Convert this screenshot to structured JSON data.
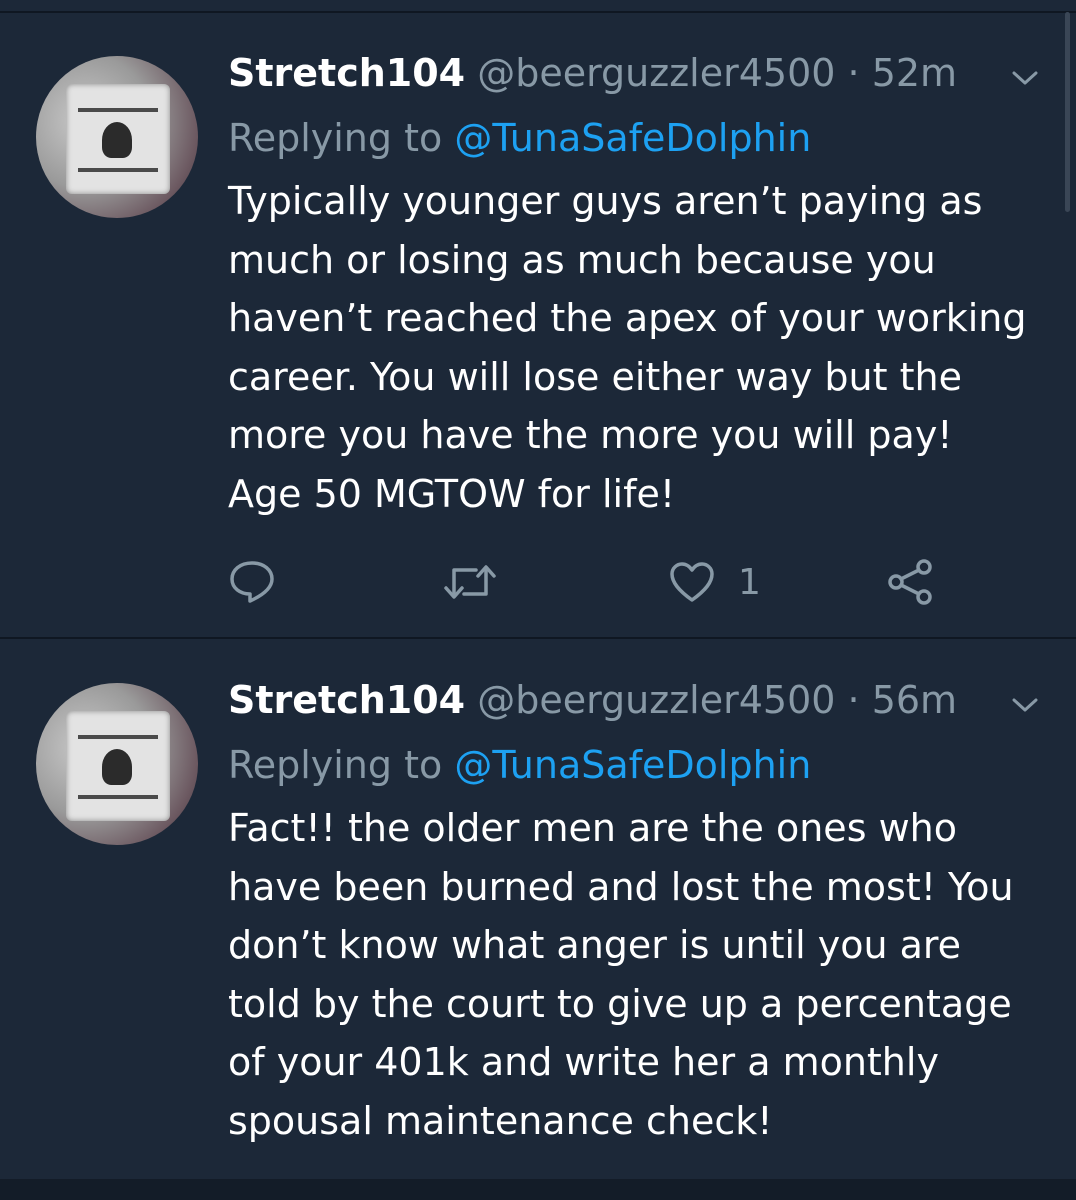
{
  "tweets": [
    {
      "display_name": "Stretch104",
      "handle": "@beerguzzler4500",
      "separator": "·",
      "time": "52m",
      "replying_prefix": "Replying to",
      "replying_to": "@TunaSafeDolphin",
      "body_lines": [
        "Typically younger guys aren’t paying as",
        "much or losing as much because you",
        "haven’t reached the apex of your working",
        "career. You will lose either way but the",
        "more you have the more you will pay!",
        "Age 50 MGTOW for life!"
      ],
      "like_count": "1"
    },
    {
      "display_name": "Stretch104",
      "handle": "@beerguzzler4500",
      "separator": "·",
      "time": "56m",
      "replying_prefix": "Replying to",
      "replying_to": "@TunaSafeDolphin",
      "body_lines": [
        "Fact!! the older men are the ones who",
        "have been burned and lost the most! You",
        "don’t know what anger is until you are",
        "told by the court to give up a percentage",
        "of your 401k and write her a monthly",
        "spousal maintenance check!"
      ]
    }
  ],
  "icons": {
    "reply": "reply-icon",
    "retweet": "retweet-icon",
    "like": "heart-icon",
    "share": "share-icon",
    "menu": "chevron-down-icon"
  },
  "colors": {
    "background": "#1c2838",
    "text": "#ffffff",
    "secondary": "#8899a6",
    "link": "#1da1f2"
  }
}
